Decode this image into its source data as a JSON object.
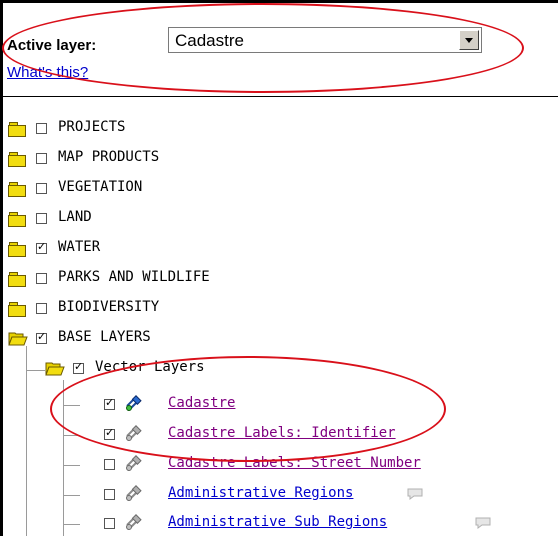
{
  "header": {
    "active_layer_label": "Active layer:",
    "active_layer_value": "Cadastre",
    "whats_this_link": "What's this?"
  },
  "tree": {
    "groups": [
      {
        "label": "PROJECTS",
        "checked": false
      },
      {
        "label": "MAP PRODUCTS",
        "checked": false
      },
      {
        "label": "VEGETATION",
        "checked": false
      },
      {
        "label": "LAND",
        "checked": false
      },
      {
        "label": "WATER",
        "checked": true
      },
      {
        "label": "PARKS AND WILDLIFE",
        "checked": false
      },
      {
        "label": "BIODIVERSITY",
        "checked": false
      },
      {
        "label": "BASE LAYERS",
        "checked": true,
        "expanded": true
      }
    ],
    "subgroup": {
      "label": "Vector Layers",
      "checked": true,
      "expanded": true
    },
    "layers": [
      {
        "label": "Cadastre",
        "checked": true,
        "color": "#800080",
        "active": true
      },
      {
        "label": "Cadastre Labels: Identifier",
        "checked": true,
        "color": "#800080"
      },
      {
        "label": "Cadastre Labels: Street Number",
        "checked": false,
        "color": "#800080"
      },
      {
        "label": "Administrative Regions",
        "checked": false,
        "color": "#0000cc",
        "has_info": true
      },
      {
        "label": "Administrative Sub Regions",
        "checked": false,
        "color": "#0000cc",
        "has_info": true
      }
    ]
  },
  "colors": {
    "annotation": "#d9101a",
    "link_visited": "#800080",
    "link": "#0000cc",
    "folder": "#f2dd10"
  }
}
